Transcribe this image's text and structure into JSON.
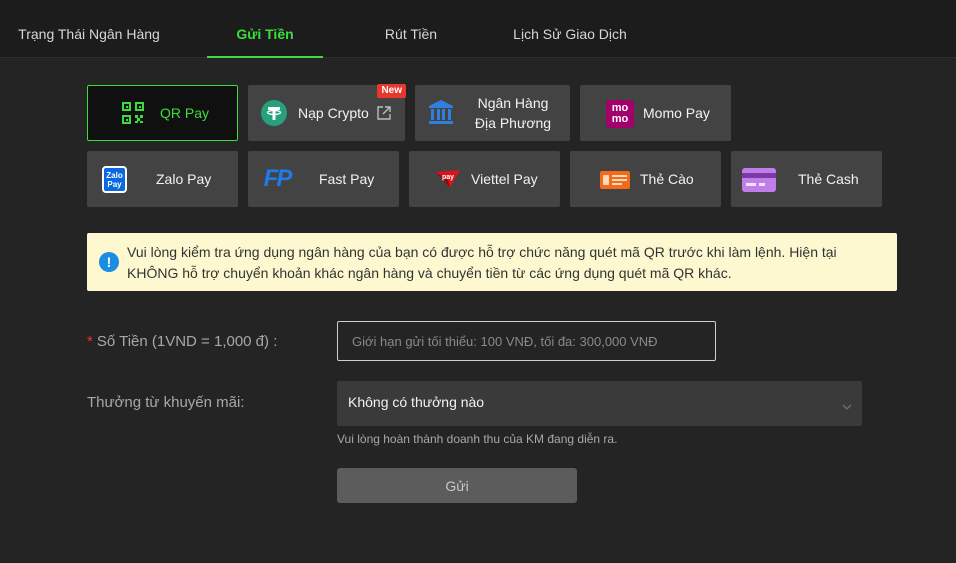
{
  "tabs": [
    {
      "label": "Trạng Thái Ngân Hàng"
    },
    {
      "label": "Gửi Tiền"
    },
    {
      "label": "Rút Tiền"
    },
    {
      "label": "Lịch Sử Giao Dịch"
    }
  ],
  "methods": {
    "qr": {
      "label": "QR Pay",
      "icon": "qr-code-icon"
    },
    "crypto": {
      "label": "Nạp Crypto",
      "badge": "New",
      "icon": "tether-icon"
    },
    "local_bank": {
      "line1": "Ngân Hàng",
      "line2": "Địa Phương",
      "icon": "bank-icon"
    },
    "momo": {
      "label": "Momo Pay",
      "icon": "momo-icon",
      "icon_text_top": "mo",
      "icon_text_bottom": "mo"
    },
    "zalo": {
      "label": "Zalo Pay",
      "icon": "zalo-icon",
      "icon_text_top": "Zalo",
      "icon_text_bottom": "Pay"
    },
    "fast": {
      "label": "Fast Pay",
      "icon": "fastpay-icon",
      "icon_text": "FP"
    },
    "viettel": {
      "label": "Viettel Pay",
      "icon": "viettel-icon",
      "icon_text": "pay"
    },
    "the_cao": {
      "label": "Thẻ Cào",
      "icon": "scratch-card-icon"
    },
    "the_cash": {
      "label": "Thẻ Cash",
      "icon": "cash-card-icon"
    }
  },
  "notice": {
    "text": "Vui lòng kiểm tra ứng dụng ngân hàng của bạn có được hỗ trợ chức năng quét mã QR trước khi làm lệnh. Hiện tại KHÔNG hỗ trợ chuyển khoản khác ngân hàng và chuyển tiền từ các ứng dụng quét mã QR khác.",
    "icon_glyph": "!"
  },
  "form": {
    "required_mark": "*",
    "amount_label": "Số Tiền (1VND = 1,000 đ) :",
    "amount_value": "",
    "amount_placeholder": "Giới hạn gửi tối thiểu: 100 VNĐ, tối đa: 300,000 VNĐ",
    "promo_label": "Thưởng từ khuyến mãi:",
    "promo_selected": "Không có thưởng nào",
    "promo_hint": "Vui lòng hoàn thành doanh thu của KM đang diễn ra.",
    "submit_label": "Gửi"
  },
  "colors": {
    "accent": "#3ddc3d",
    "notice_bg": "#fdf8cf",
    "info_icon": "#1b8ce4",
    "required": "#e8372b"
  }
}
